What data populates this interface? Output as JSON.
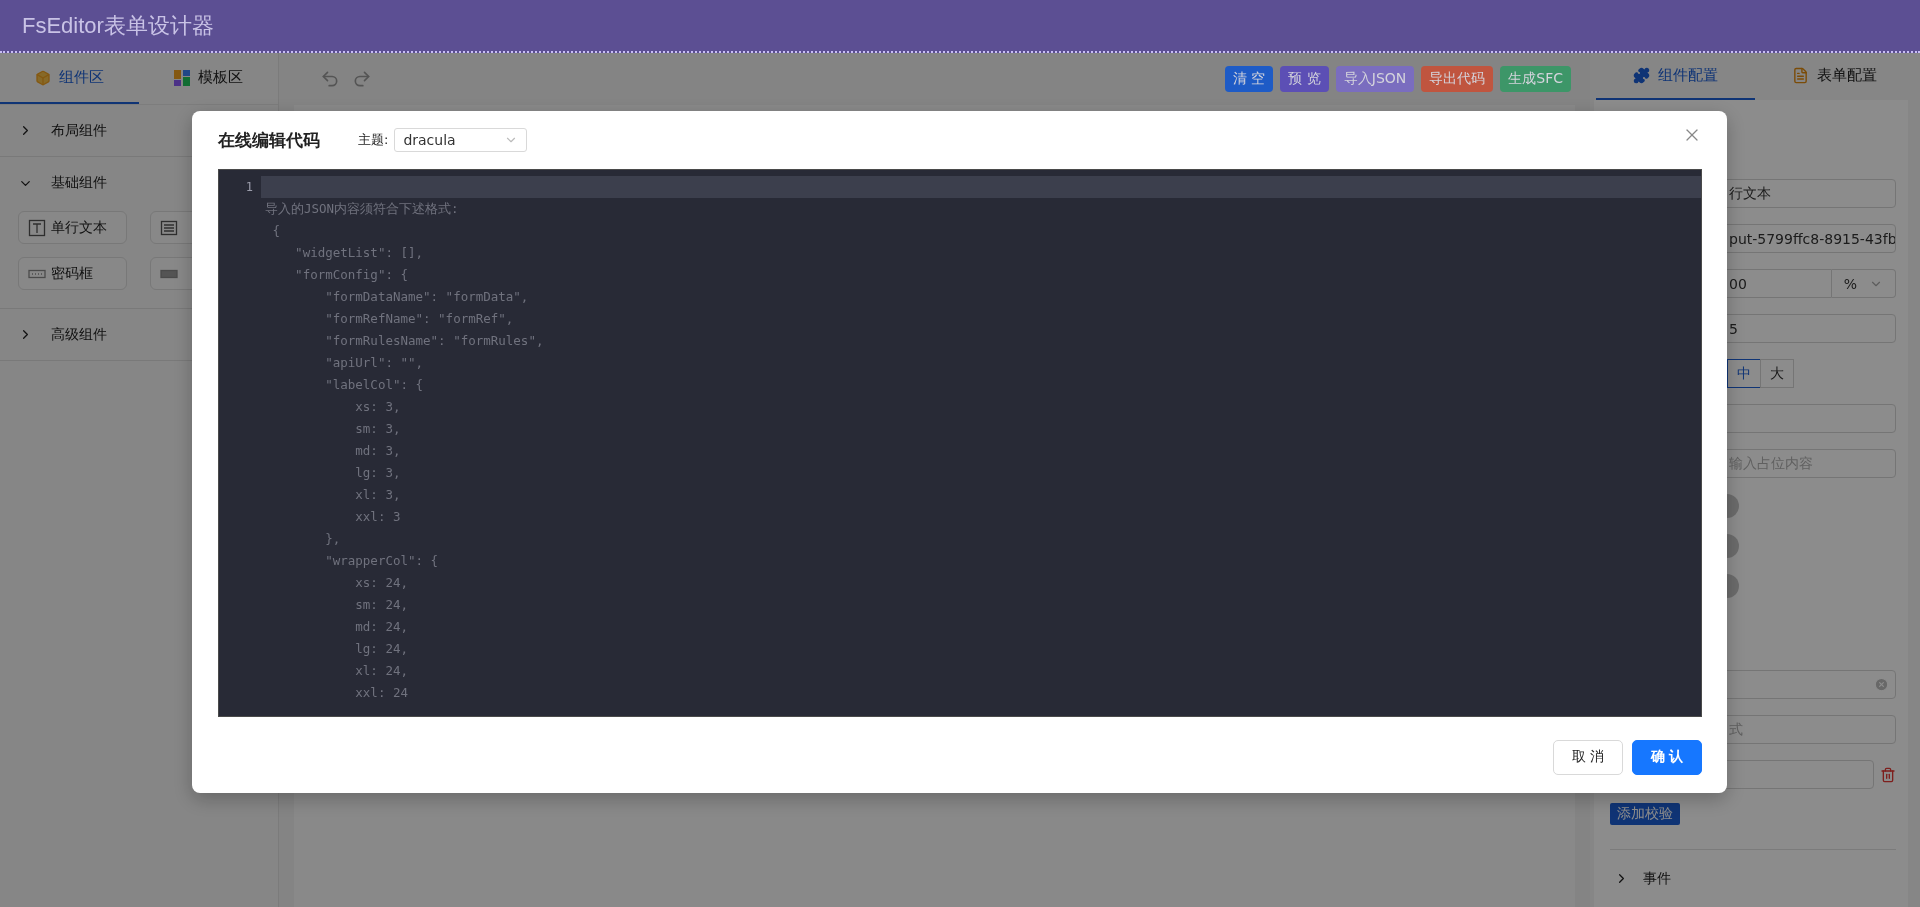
{
  "header": {
    "title": "FsEditor表单设计器"
  },
  "left_panel": {
    "tabs": [
      {
        "label": "组件区",
        "selected": true
      },
      {
        "label": "模板区",
        "selected": false
      }
    ],
    "groups": [
      {
        "title": "布局组件",
        "expanded": false
      },
      {
        "title": "基础组件",
        "expanded": true,
        "items": [
          {
            "kind": "text",
            "label": "单行文本"
          },
          {
            "kind": "textarea"
          },
          {
            "kind": "password",
            "label": "密码框"
          },
          {
            "kind": "number"
          }
        ]
      },
      {
        "title": "高级组件",
        "expanded": false
      }
    ]
  },
  "toolbar": {
    "buttons": [
      {
        "label": "清 空",
        "color": "#1e5bc6"
      },
      {
        "label": "预 览",
        "color": "#5c4fb5"
      },
      {
        "label": "导入JSON",
        "color": "#7a6dbf"
      },
      {
        "label": "导出代码",
        "color": "#c0553f"
      },
      {
        "label": "生成SFC",
        "color": "#3d9668"
      }
    ]
  },
  "right_panel": {
    "tabs": [
      {
        "label": "组件配置",
        "selected": true
      },
      {
        "label": "表单配置",
        "selected": false
      }
    ],
    "fields": [
      {
        "kind": "input",
        "value": "行文本"
      },
      {
        "kind": "input",
        "value": "put-5799ffc8-8915-43fb"
      },
      {
        "kind": "unit",
        "value": "00",
        "unit": "%"
      },
      {
        "kind": "input",
        "value": "5"
      },
      {
        "kind": "size",
        "options": [
          {
            "label": "中",
            "selected": true
          },
          {
            "label": "大",
            "selected": false
          }
        ]
      },
      {
        "kind": "input"
      },
      {
        "kind": "input",
        "placeholder": "输入占位内容"
      },
      {
        "kind": "switch",
        "on": false
      },
      {
        "kind": "switch",
        "on": false
      },
      {
        "kind": "switch",
        "on": false
      },
      {
        "kind": "clearable"
      },
      {
        "kind": "input",
        "placeholder": "式"
      },
      {
        "kind": "deletable"
      }
    ],
    "add_button": "添加校验",
    "events": {
      "title": "事件",
      "expanded": false
    }
  },
  "dialog": {
    "title": "在线编辑代码",
    "theme_label": "主题:",
    "theme": "dracula",
    "line_numbers": [
      "1"
    ],
    "code_lines": [
      "导入的JSON内容须符合下述格式:",
      " {",
      "    \"widgetList\": [],",
      "    \"formConfig\": {",
      "        \"formDataName\": \"formData\",",
      "        \"formRefName\": \"formRef\",",
      "        \"formRulesName\": \"formRules\",",
      "        \"apiUrl\": \"\",",
      "        \"labelCol\": {",
      "            xs: 3,",
      "            sm: 3,",
      "            md: 3,",
      "            lg: 3,",
      "            xl: 3,",
      "            xxl: 3",
      "        },",
      "        \"wrapperCol\": {",
      "            xs: 24,",
      "            sm: 24,",
      "            md: 24,",
      "            lg: 24,",
      "            xl: 24,",
      "            xxl: 24"
    ],
    "buttons": [
      {
        "label": "取 消",
        "kind": "default"
      },
      {
        "label": "确 认",
        "kind": "primary"
      }
    ]
  }
}
